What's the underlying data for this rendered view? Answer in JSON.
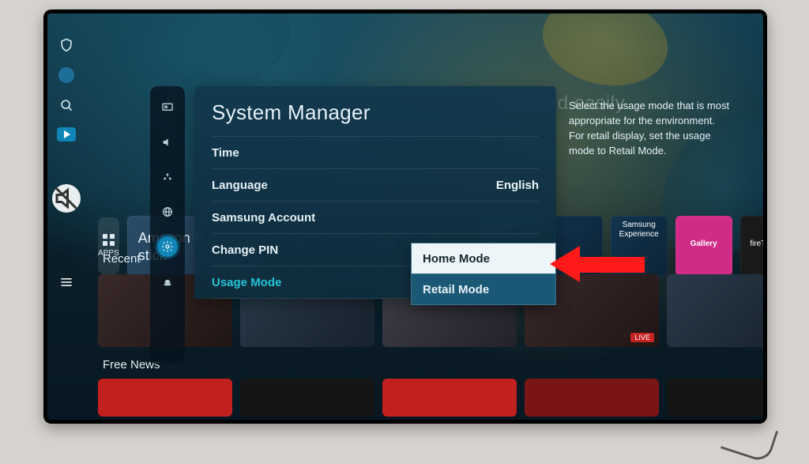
{
  "sysbar": {
    "shield_name": "privacy-shield-icon",
    "notify_name": "notification-dot-icon",
    "search_name": "search-icon",
    "play_name": "play-app-icon",
    "mute_name": "mute-icon",
    "menu_name": "menu-icon"
  },
  "hero": {
    "line1": "E",
    "line2": "kly and easily"
  },
  "apps": {
    "button_label": "APPS",
    "big_label": "Amazon F…\nstick",
    "tiles": [
      {
        "name": "app-tile-1",
        "label": ""
      },
      {
        "name": "app-tile-2",
        "label": ""
      },
      {
        "name": "app-tile-samsung",
        "label": "Samsung Experience"
      },
      {
        "name": "app-tile-gallery",
        "label": "Gallery"
      },
      {
        "name": "app-tile-firetv",
        "label": "fireTVstick"
      }
    ]
  },
  "rows": {
    "recent_title": "Recent",
    "news_title": "Free News",
    "live_badge": "LIVE"
  },
  "settings_sidebar": {
    "items": [
      {
        "name": "picture-icon"
      },
      {
        "name": "sound-icon"
      },
      {
        "name": "broadcast-icon"
      },
      {
        "name": "network-icon"
      },
      {
        "name": "system-icon",
        "active": true
      },
      {
        "name": "support-icon"
      }
    ]
  },
  "panel": {
    "title": "System Manager",
    "rows": [
      {
        "label": "Time",
        "value": ""
      },
      {
        "label": "Language",
        "value": "English"
      },
      {
        "label": "Samsung Account",
        "value": ""
      },
      {
        "label": "Change PIN",
        "value": ""
      },
      {
        "label": "Usage Mode",
        "value": "",
        "active": true
      }
    ]
  },
  "dropdown": {
    "options": [
      {
        "label": "Home Mode",
        "selected": true
      },
      {
        "label": "Retail Mode",
        "selected": false
      }
    ]
  },
  "help": {
    "text": "Select the usage mode that is most appropriate for the environment. For retail display, set the usage mode to Retail Mode."
  }
}
